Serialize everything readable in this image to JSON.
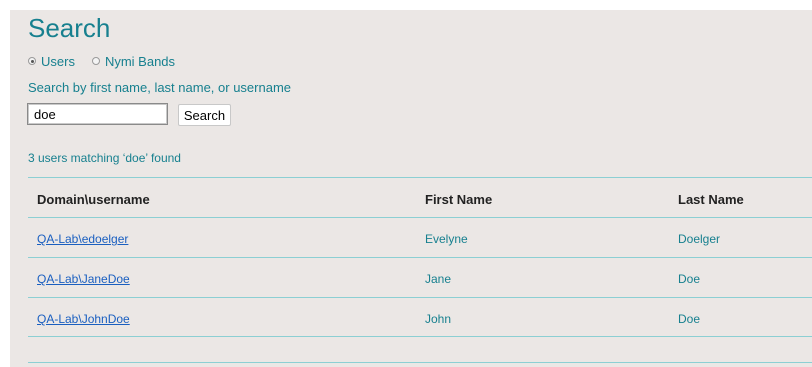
{
  "page": {
    "title": "Search"
  },
  "search_type": {
    "options": [
      {
        "label": "Users",
        "selected": true
      },
      {
        "label": "Nymi Bands",
        "selected": false
      }
    ]
  },
  "search": {
    "hint": "Search by first name, last name, or username",
    "value": "doe",
    "button_label": "Search"
  },
  "results": {
    "summary": "3 users matching ‘doe’ found",
    "columns": [
      "Domain\\username",
      "First Name",
      "Last Name"
    ],
    "rows": [
      {
        "username": "QA-Lab\\edoelger",
        "first": "Evelyne",
        "last": "Doelger"
      },
      {
        "username": "QA-Lab\\JaneDoe",
        "first": "Jane",
        "last": "Doe"
      },
      {
        "username": "QA-Lab\\JohnDoe",
        "first": "John",
        "last": "Doe"
      }
    ]
  },
  "colors": {
    "accent": "#17808f",
    "link": "#1a5fc0",
    "divider": "#8ccfd3",
    "panel_bg": "#ebe7e5"
  }
}
